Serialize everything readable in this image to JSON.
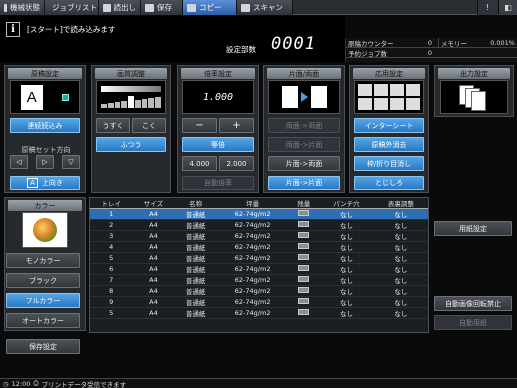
{
  "tabs": [
    {
      "label": "機械状態",
      "icon": "machine-icon"
    },
    {
      "label": "ジョブリスト",
      "icon": "job-list-icon"
    },
    {
      "label": "読出し",
      "icon": "recall-icon"
    },
    {
      "label": "保存",
      "icon": "save-icon"
    },
    {
      "label": "コピー",
      "icon": "copy-icon",
      "active": true
    },
    {
      "label": "スキャン",
      "icon": "scan-icon"
    }
  ],
  "message": "[スタート]で読み込みます",
  "set_count_label": "設定部数",
  "set_count": "0001",
  "counters": {
    "orig_label": "原稿カウンター",
    "orig_value": "0",
    "memory_label": "メモリー",
    "memory_value": "0.001%",
    "reserve_label": "予約ジョブ数",
    "reserve_value": "0"
  },
  "original": {
    "title": "原稿設定",
    "preview_letter": "A",
    "continuous": "連続読込み",
    "direction_title": "原稿セット方向",
    "direction_up": "上向き"
  },
  "density": {
    "title": "画質調整",
    "light": "うすく",
    "dark": "こく",
    "normal": "ふつう"
  },
  "zoom": {
    "title": "倍率設定",
    "value": "1.000",
    "minus": "−",
    "plus": "+",
    "equal": "等倍",
    "preset1": "4.000",
    "preset2": "2.000",
    "auto": "自動倍率"
  },
  "duplex": {
    "title": "片面/両面",
    "d2d": "両面->両面",
    "d2s": "両面->片面",
    "s2d": "片面->両面",
    "s2s": "片面->片面"
  },
  "apply": {
    "title": "応用設定",
    "interleave": "インターシート",
    "erase": "原稿外消去",
    "fold": "枠/折り目消し",
    "binding": "とじしろ"
  },
  "output": {
    "title": "出力設定"
  },
  "color": {
    "title": "カラー",
    "mono": "モノカラー",
    "black": "ブラック",
    "full": "フルカラー",
    "auto": "オートカラー"
  },
  "save_settings": "保存設定",
  "table": {
    "headers": [
      "トレイ",
      "サイズ",
      "名称",
      "坪量",
      "残量",
      "パンチ穴",
      "表裏調整"
    ],
    "rows": [
      [
        "1",
        "A4",
        "普通紙",
        "62-74g/m2",
        "",
        "なし",
        "なし"
      ],
      [
        "2",
        "A4",
        "普通紙",
        "62-74g/m2",
        "",
        "なし",
        "なし"
      ],
      [
        "3",
        "A4",
        "普通紙",
        "62-74g/m2",
        "",
        "なし",
        "なし"
      ],
      [
        "4",
        "A4",
        "普通紙",
        "62-74g/m2",
        "",
        "なし",
        "なし"
      ],
      [
        "5",
        "A4",
        "普通紙",
        "62-74g/m2",
        "",
        "なし",
        "なし"
      ],
      [
        "6",
        "A4",
        "普通紙",
        "62-74g/m2",
        "",
        "なし",
        "なし"
      ],
      [
        "7",
        "A4",
        "普通紙",
        "62-74g/m2",
        "",
        "なし",
        "なし"
      ],
      [
        "8",
        "A4",
        "普通紙",
        "62-74g/m2",
        "",
        "なし",
        "なし"
      ],
      [
        "9",
        "A4",
        "普通紙",
        "62-74g/m2",
        "",
        "なし",
        "なし"
      ],
      [
        "5",
        "A4",
        "普通紙",
        "62-74g/m2",
        "",
        "なし",
        "なし"
      ]
    ]
  },
  "paper_settings": "用紙設定",
  "auto_rotate_off": "自動画像回転禁止",
  "auto_paper": "自動用紙",
  "status": {
    "time": "12:00",
    "message": "プリントデータ受信できます"
  }
}
